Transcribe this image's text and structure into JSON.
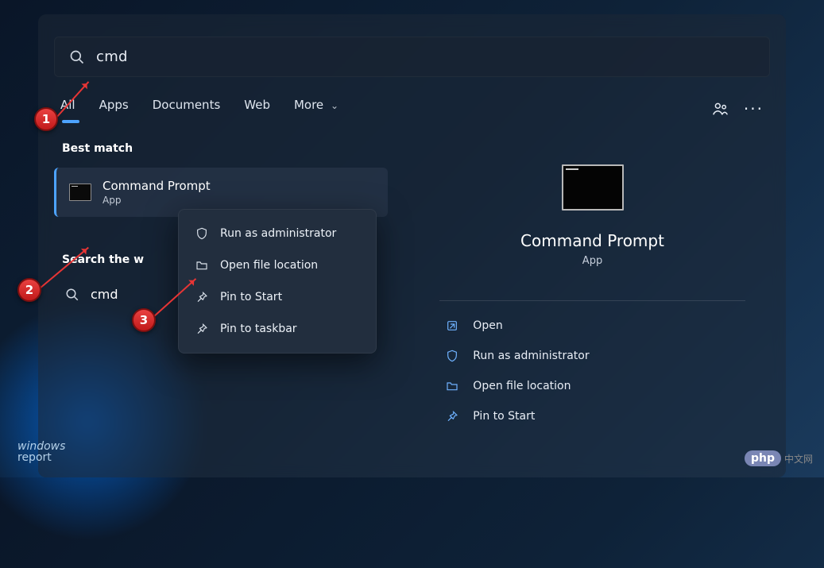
{
  "search": {
    "query": "cmd"
  },
  "tabs": {
    "all": "All",
    "apps": "Apps",
    "documents": "Documents",
    "web": "Web",
    "more": "More"
  },
  "best_match": {
    "label": "Best match",
    "title": "Command Prompt",
    "subtitle": "App"
  },
  "search_web": {
    "label": "Search the web",
    "item": "cmd"
  },
  "context_menu": {
    "run_admin": "Run as administrator",
    "open_loc": "Open file location",
    "pin_start": "Pin to Start",
    "pin_taskbar": "Pin to taskbar"
  },
  "preview": {
    "title": "Command Prompt",
    "subtitle": "App",
    "actions": {
      "open": "Open",
      "run_admin": "Run as administrator",
      "open_loc": "Open file location",
      "pin_start": "Pin to Start"
    }
  },
  "badges": {
    "b1": "1",
    "b2": "2",
    "b3": "3"
  },
  "watermarks": {
    "wr1": "windows",
    "wr2": "report",
    "php": "php",
    "cn": "中文网"
  }
}
